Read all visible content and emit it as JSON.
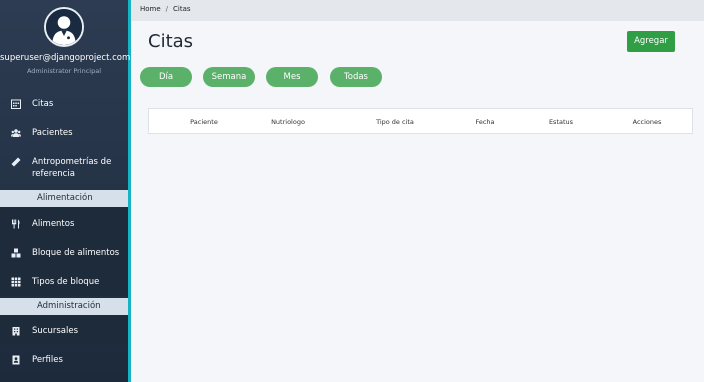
{
  "sidebar": {
    "user_email": "superuser@djangoproject.com",
    "user_role": "Administrator Principal",
    "items": [
      {
        "label": "Citas",
        "icon": "calendar-icon"
      },
      {
        "label": "Pacientes",
        "icon": "users-icon"
      },
      {
        "label": "Antropometrías de referencia",
        "icon": "ruler-icon"
      }
    ],
    "section_alimentacion": "Alimentación",
    "items_alimentacion": [
      {
        "label": "Alimentos",
        "icon": "utensils-icon"
      },
      {
        "label": "Bloque de alimentos",
        "icon": "cubes-icon"
      },
      {
        "label": "Tipos de bloque",
        "icon": "grid-icon"
      }
    ],
    "section_administracion": "Administración",
    "items_administracion": [
      {
        "label": "Sucursales",
        "icon": "building-icon"
      },
      {
        "label": "Perfiles",
        "icon": "id-card-icon"
      }
    ]
  },
  "breadcrumb": {
    "home": "Home",
    "separator": "/",
    "current": "Citas"
  },
  "main": {
    "title": "Citas",
    "add_label": "Agregar",
    "filters": [
      "Día",
      "Semana",
      "Mes",
      "Todas"
    ],
    "table_headers": [
      "Paciente",
      "Nutriologo",
      "Tipo de cita",
      "Fecha",
      "Estatus",
      "Acciones"
    ]
  },
  "colors": {
    "sidebar_bg": "#2d3c52",
    "sidebar_accent": "#17b3c4",
    "section_bg": "#d6e0ea",
    "add_button": "#2f9e44",
    "filter_pill": "#5bb06a"
  }
}
